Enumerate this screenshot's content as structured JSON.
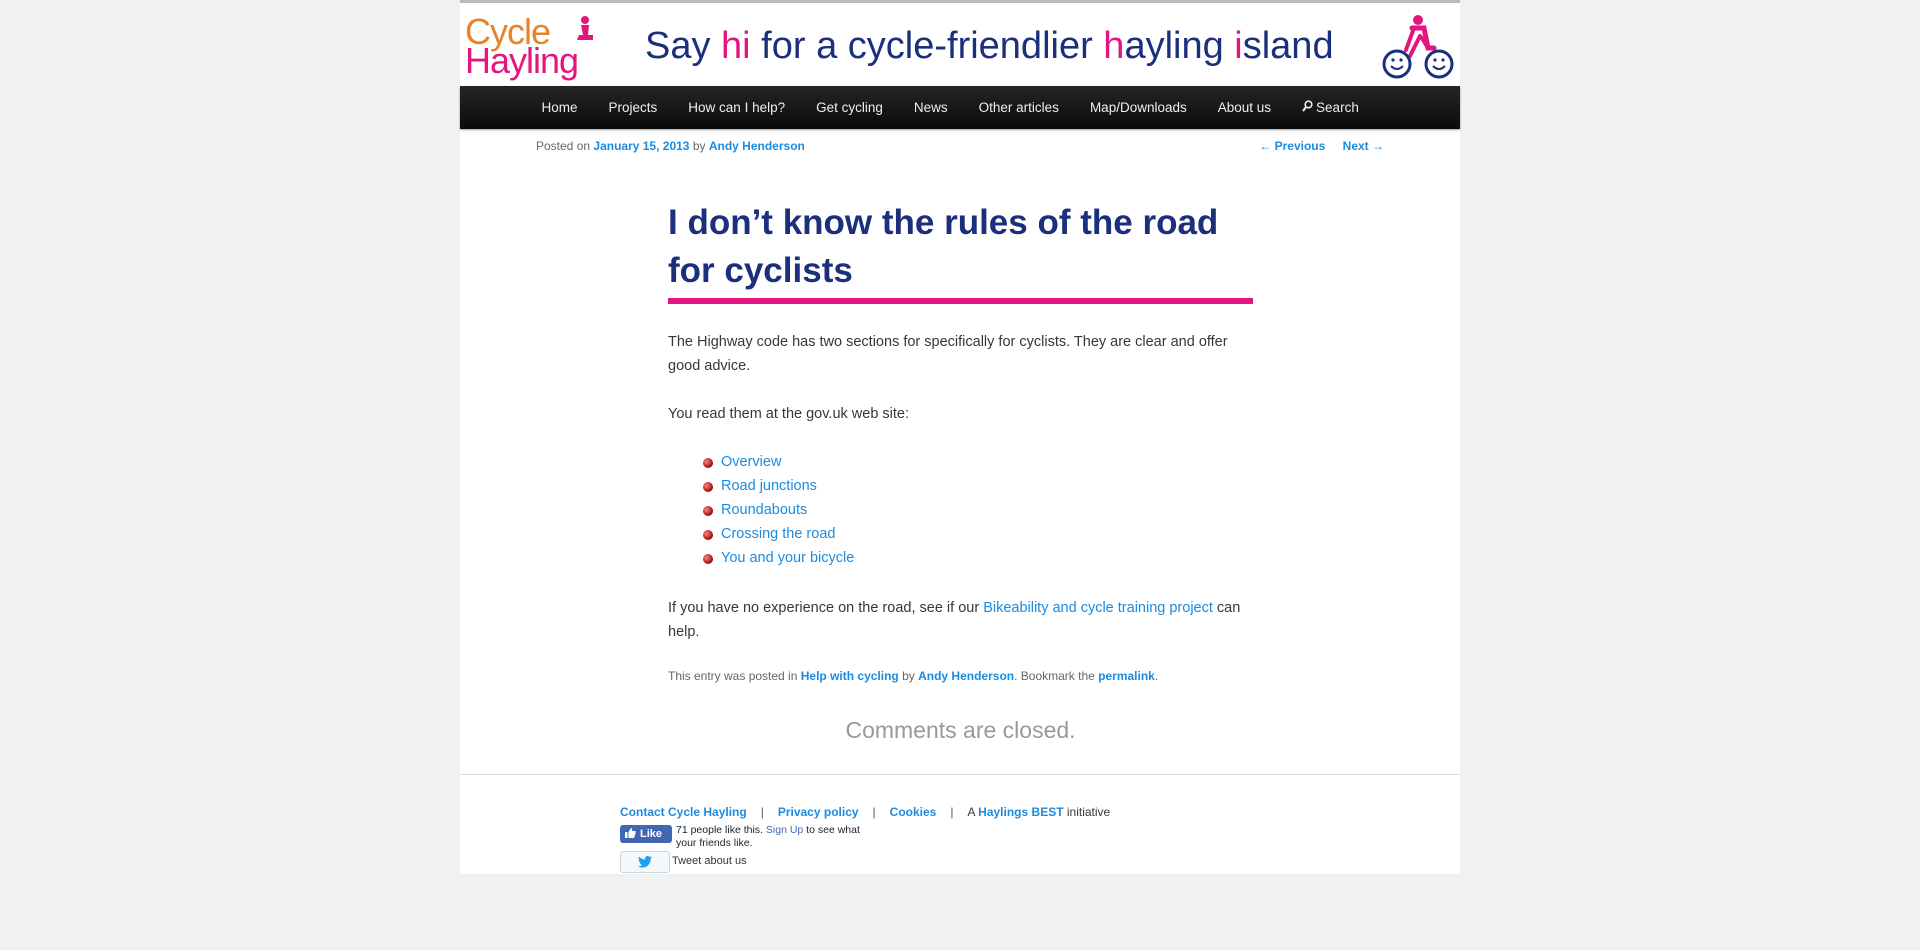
{
  "header": {
    "logo_line1": "Cycle",
    "logo_line2": "Hayling",
    "tagline_parts": [
      "Say ",
      "hi",
      " for a cycle-friendlier ",
      "h",
      "ayling ",
      "i",
      "sland"
    ],
    "brand_colors": {
      "navy": "#1b2f7d",
      "pink": "#e5157f",
      "orange": "#e8832a"
    }
  },
  "nav": {
    "items": [
      "Home",
      "Projects",
      "How can I help?",
      "Get cycling",
      "News",
      "Other articles",
      "Map/Downloads",
      "About us"
    ],
    "search_label": "Search",
    "search_icon": "magnifier-icon"
  },
  "post": {
    "posted_on_label": "Posted on",
    "date": "January 15, 2013",
    "by_label": "by",
    "author": "Andy Henderson",
    "prev_label": "← Previous",
    "next_label": "Next →",
    "title": "I don’t know the rules of the road for cyclists",
    "para1": "The Highway code has two sections for specifically for cyclists.  They are clear and offer good advice.",
    "para2": "You read them at the gov.uk web site:",
    "links": [
      "Overview",
      "Road junctions",
      "Roundabouts",
      "Crossing the road",
      "You and your bicycle"
    ],
    "para3_prefix": "If you have no experience on the road, see if our ",
    "para3_link": "Bikeability and cycle training project",
    "para3_suffix": " can help.",
    "footer_prefix": "This entry was posted in ",
    "footer_category": "Help with cycling",
    "footer_by": " by ",
    "footer_author": "Andy Henderson",
    "footer_mid": ". Bookmark the ",
    "footer_permalink": "permalink",
    "footer_end": ".",
    "comments_closed": "Comments are closed."
  },
  "footer": {
    "contact": "Contact Cycle Hayling",
    "privacy": "Privacy policy",
    "cookies": "Cookies",
    "separator": "|",
    "initiative_prefix": "A ",
    "initiative_link": "Haylings BEST",
    "initiative_suffix": " initiative",
    "fb_like": "Like",
    "fb_count_text": "71 people like this. ",
    "fb_signup": "Sign Up",
    "fb_suffix": " to see what your friends like.",
    "tweet_text": "Tweet about us"
  }
}
